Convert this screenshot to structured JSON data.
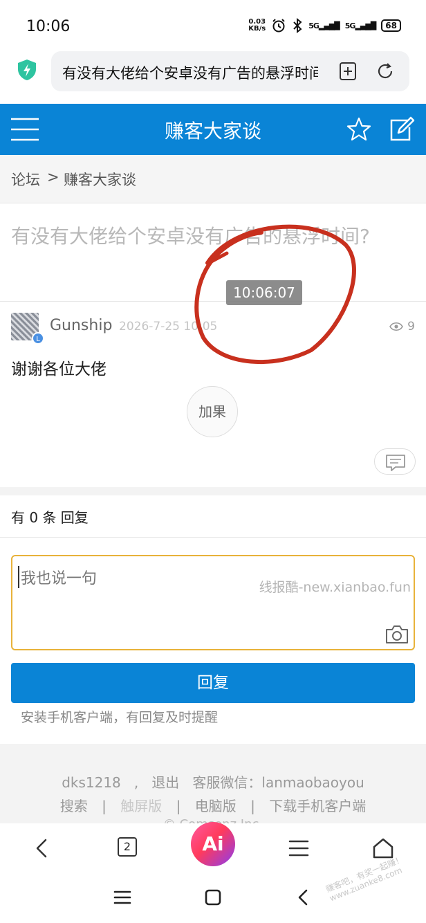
{
  "status_bar": {
    "time": "10:06",
    "net_speed_value": "0.03",
    "net_speed_unit": "KB/s",
    "signal1": "5G",
    "signal2": "5G",
    "battery": "68"
  },
  "address_bar": {
    "url_text": "有没有大佬给个安卓没有广告的悬浮时间?"
  },
  "header": {
    "title": "赚客大家谈"
  },
  "breadcrumb": {
    "root": "论坛",
    "separator": ">",
    "current": "赚客大家谈"
  },
  "thread": {
    "title": "有没有大佬给个安卓没有广告的悬浮时间?"
  },
  "post": {
    "author": "Gunship",
    "level_badge": "L",
    "time": "2026-7-25 10:05",
    "views": "9",
    "body": "谢谢各位大佬",
    "add_fruit_label": "加果"
  },
  "overlay": {
    "timestamp": "10:06:07",
    "annotation_color": "#c8301e"
  },
  "replies": {
    "count_text": "有 0 条 回复",
    "placeholder": "我也说一句",
    "watermark": "线报酷-new.xianbao.fun",
    "submit_label": "回复",
    "install_tip": "安装手机客户端，有回复及时提醒"
  },
  "footer": {
    "user": "dks1218",
    "comma": ",",
    "logout": "退出",
    "service": "客服微信：lanmaobaoyou",
    "links": {
      "search": "搜索",
      "touch": "触屏版",
      "pc": "电脑版",
      "download": "下载手机客户端"
    },
    "sep": "|",
    "copyright": "© Comsenz Inc."
  },
  "browser_nav": {
    "tab_count": "2",
    "ai_label": "Ai"
  },
  "corner_watermark": {
    "line1": "赚客吧，有奖一起赚！",
    "line2": "www.zuanke8.com"
  },
  "colors": {
    "header_blue": "#0a84d6",
    "reply_box_border": "#e8b23a",
    "shield_green": "#2ec4a0"
  }
}
